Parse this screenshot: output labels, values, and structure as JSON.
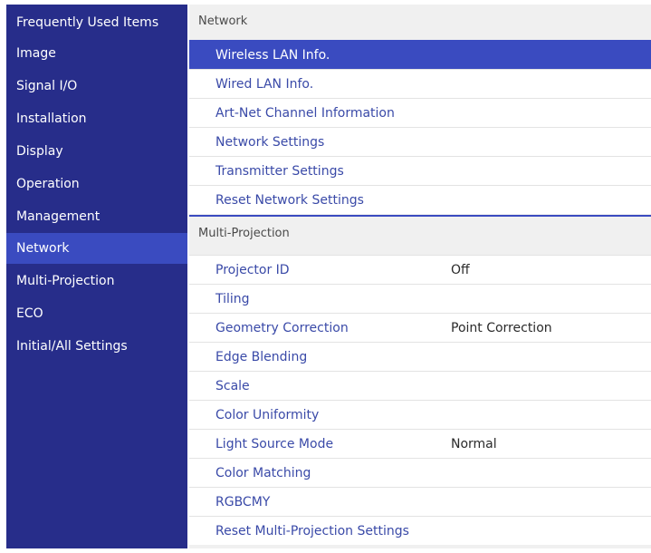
{
  "sidebar": {
    "items": [
      {
        "label": "Frequently Used Items"
      },
      {
        "label": "Image"
      },
      {
        "label": "Signal I/O"
      },
      {
        "label": "Installation"
      },
      {
        "label": "Display"
      },
      {
        "label": "Operation"
      },
      {
        "label": "Management"
      },
      {
        "label": "Network",
        "active": true
      },
      {
        "label": "Multi-Projection"
      },
      {
        "label": "ECO"
      },
      {
        "label": "Initial/All Settings"
      }
    ]
  },
  "network": {
    "header": "Network",
    "items": [
      {
        "label": "Wireless LAN Info.",
        "selected": true
      },
      {
        "label": "Wired LAN Info."
      },
      {
        "label": "Art-Net Channel Information"
      },
      {
        "label": "Network Settings"
      },
      {
        "label": "Transmitter Settings"
      },
      {
        "label": "Reset Network Settings"
      }
    ]
  },
  "multi_projection": {
    "header": "Multi-Projection",
    "items": [
      {
        "label": "Projector ID",
        "value": "Off"
      },
      {
        "label": "Tiling"
      },
      {
        "label": "Geometry Correction",
        "value": "Point Correction"
      },
      {
        "label": "Edge Blending"
      },
      {
        "label": "Scale"
      },
      {
        "label": "Color Uniformity"
      },
      {
        "label": "Light Source Mode",
        "value": "Normal"
      },
      {
        "label": "Color Matching"
      },
      {
        "label": "RGBCMY"
      },
      {
        "label": "Reset Multi-Projection Settings"
      }
    ]
  },
  "colors": {
    "sidebar_bg": "#272d8a",
    "accent": "#3a4bc0",
    "item_text": "#3a4aa8",
    "panel_bg": "#f0f0f0"
  }
}
